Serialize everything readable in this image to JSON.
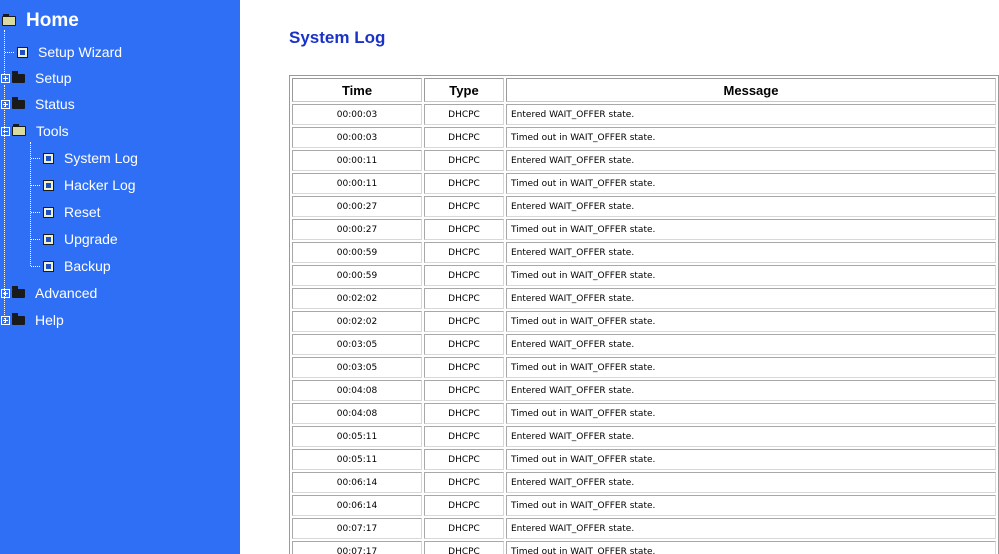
{
  "sidebar": {
    "home": "Home",
    "items": [
      {
        "label": "Setup Wizard"
      },
      {
        "label": "Setup"
      },
      {
        "label": "Status"
      },
      {
        "label": "Tools"
      },
      {
        "label": "System Log"
      },
      {
        "label": "Hacker Log"
      },
      {
        "label": "Reset"
      },
      {
        "label": "Upgrade"
      },
      {
        "label": "Backup"
      },
      {
        "label": "Advanced"
      },
      {
        "label": "Help"
      }
    ]
  },
  "main": {
    "title": "System Log",
    "columns": {
      "time": "Time",
      "type": "Type",
      "message": "Message"
    },
    "rows": [
      {
        "time": "00:00:03",
        "type": "DHCPC",
        "message": "Entered WAIT_OFFER state."
      },
      {
        "time": "00:00:03",
        "type": "DHCPC",
        "message": "Timed out in WAIT_OFFER state."
      },
      {
        "time": "00:00:11",
        "type": "DHCPC",
        "message": "Entered WAIT_OFFER state."
      },
      {
        "time": "00:00:11",
        "type": "DHCPC",
        "message": "Timed out in WAIT_OFFER state."
      },
      {
        "time": "00:00:27",
        "type": "DHCPC",
        "message": "Entered WAIT_OFFER state."
      },
      {
        "time": "00:00:27",
        "type": "DHCPC",
        "message": "Timed out in WAIT_OFFER state."
      },
      {
        "time": "00:00:59",
        "type": "DHCPC",
        "message": "Entered WAIT_OFFER state."
      },
      {
        "time": "00:00:59",
        "type": "DHCPC",
        "message": "Timed out in WAIT_OFFER state."
      },
      {
        "time": "00:02:02",
        "type": "DHCPC",
        "message": "Entered WAIT_OFFER state."
      },
      {
        "time": "00:02:02",
        "type": "DHCPC",
        "message": "Timed out in WAIT_OFFER state."
      },
      {
        "time": "00:03:05",
        "type": "DHCPC",
        "message": "Entered WAIT_OFFER state."
      },
      {
        "time": "00:03:05",
        "type": "DHCPC",
        "message": "Timed out in WAIT_OFFER state."
      },
      {
        "time": "00:04:08",
        "type": "DHCPC",
        "message": "Entered WAIT_OFFER state."
      },
      {
        "time": "00:04:08",
        "type": "DHCPC",
        "message": "Timed out in WAIT_OFFER state."
      },
      {
        "time": "00:05:11",
        "type": "DHCPC",
        "message": "Entered WAIT_OFFER state."
      },
      {
        "time": "00:05:11",
        "type": "DHCPC",
        "message": "Timed out in WAIT_OFFER state."
      },
      {
        "time": "00:06:14",
        "type": "DHCPC",
        "message": "Entered WAIT_OFFER state."
      },
      {
        "time": "00:06:14",
        "type": "DHCPC",
        "message": "Timed out in WAIT_OFFER state."
      },
      {
        "time": "00:07:17",
        "type": "DHCPC",
        "message": "Entered WAIT_OFFER state."
      },
      {
        "time": "00:07:17",
        "type": "DHCPC",
        "message": "Timed out in WAIT_OFFER state."
      }
    ]
  },
  "colors": {
    "sidebar_bg": "#2e6ff5",
    "title": "#1a32c8"
  }
}
